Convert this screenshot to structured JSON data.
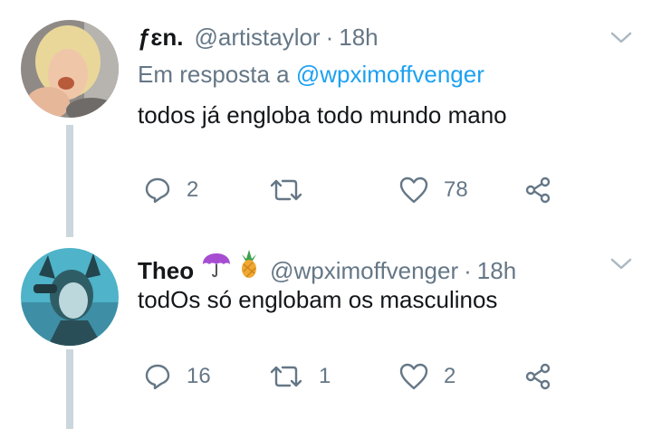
{
  "tweets": [
    {
      "name": "ƒɛn.",
      "handle": "@artistaylor",
      "separator": "·",
      "time": "18h",
      "reply_prefix": "Em resposta a ",
      "reply_to": "@wpximoffvenger",
      "text": "todos já engloba todo mundo mano",
      "reply_count": "2",
      "retweet_count": "",
      "like_count": "78"
    },
    {
      "name": "Theo",
      "emojis": [
        "umbrella-emoji",
        "pineapple-emoji"
      ],
      "handle": "@wpximoffvenger",
      "separator": "·",
      "time": "18h",
      "text": "todOs só englobam os masculinos",
      "reply_count": "16",
      "retweet_count": "1",
      "like_count": "2"
    }
  ],
  "colors": {
    "text": "#14171a",
    "secondary": "#657786",
    "link": "#1da1f2",
    "thread": "#ccd6dd"
  }
}
